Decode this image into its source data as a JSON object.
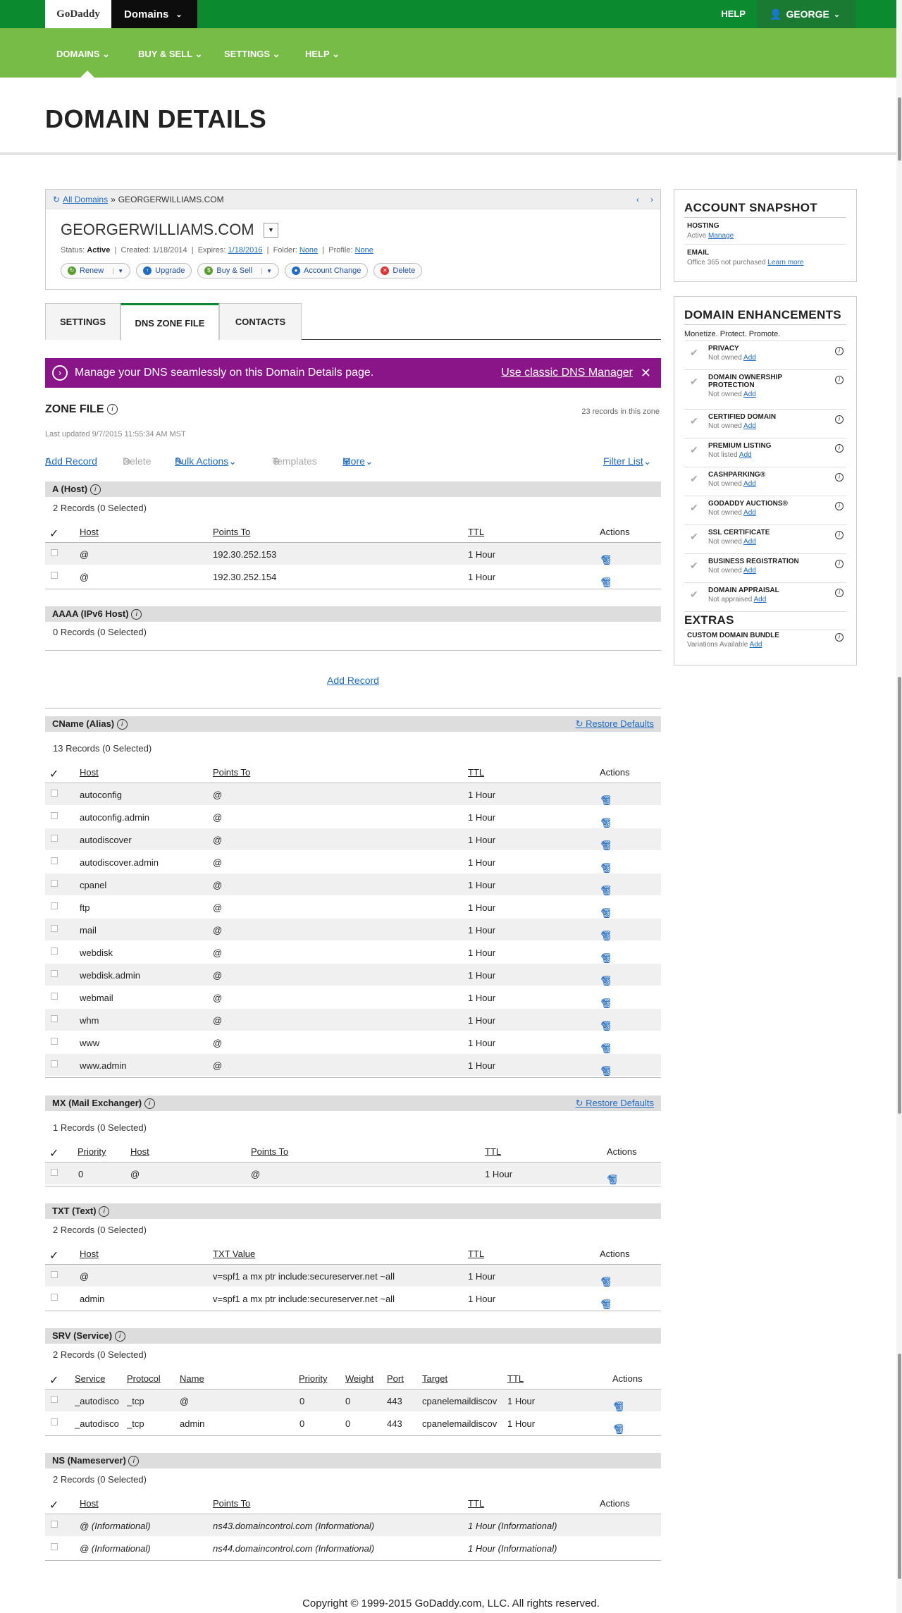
{
  "topbar": {
    "logo": "GoDaddy",
    "domains_label": "Domains",
    "help": "HELP",
    "user": "GEORGE"
  },
  "nav": {
    "items": [
      "DOMAINS",
      "BUY & SELL",
      "SETTINGS",
      "HELP"
    ]
  },
  "page": {
    "title": "DOMAIN DETAILS"
  },
  "card": {
    "breadcrumb_link": "All Domains",
    "breadcrumb_sep": "»",
    "breadcrumb_current": "GEORGERWILLIAMS.COM",
    "domain": "GEORGERWILLIAMS.COM",
    "status_label": "Status:",
    "status": "Active",
    "created": "Created: 1/18/2014",
    "expires_label": "Expires:",
    "expires": "1/18/2016",
    "folder_label": "Folder:",
    "folder": "None",
    "profile_label": "Profile:",
    "profile": "None",
    "actions": [
      "Renew",
      "Upgrade",
      "Buy & Sell",
      "Account Change",
      "Delete"
    ]
  },
  "tabs": [
    "SETTINGS",
    "DNS ZONE FILE",
    "CONTACTS"
  ],
  "banner": {
    "text": "Manage your DNS seamlessly on this Domain Details page.",
    "link": "Use classic DNS Manager",
    "close": "✕"
  },
  "zone": {
    "title": "ZONE FILE",
    "count": "23 records in this zone",
    "updated": "Last updated 9/7/2015 11:55:34 AM MST",
    "toolbar": {
      "add": "Add Record",
      "delete": "Delete",
      "bulk": "Bulk Actions",
      "templates": "Templates",
      "more": "More",
      "filter": "Filter List"
    }
  },
  "a": {
    "title": "A (Host)",
    "count": "2 Records (0 Selected)",
    "headers": [
      "Host",
      "Points To",
      "TTL",
      "Actions"
    ],
    "rows": [
      [
        "@",
        "192.30.252.153",
        "1 Hour"
      ],
      [
        "@",
        "192.30.252.154",
        "1 Hour"
      ]
    ]
  },
  "aaaa": {
    "title": "AAAA (IPv6 Host)",
    "count": "0 Records (0 Selected)",
    "add": "Add Record"
  },
  "cname": {
    "title": "CName (Alias)",
    "restore": "Restore Defaults",
    "count": "13 Records (0 Selected)",
    "headers": [
      "Host",
      "Points To",
      "TTL",
      "Actions"
    ],
    "rows": [
      [
        "autoconfig",
        "@",
        "1 Hour"
      ],
      [
        "autoconfig.admin",
        "@",
        "1 Hour"
      ],
      [
        "autodiscover",
        "@",
        "1 Hour"
      ],
      [
        "autodiscover.admin",
        "@",
        "1 Hour"
      ],
      [
        "cpanel",
        "@",
        "1 Hour"
      ],
      [
        "ftp",
        "@",
        "1 Hour"
      ],
      [
        "mail",
        "@",
        "1 Hour"
      ],
      [
        "webdisk",
        "@",
        "1 Hour"
      ],
      [
        "webdisk.admin",
        "@",
        "1 Hour"
      ],
      [
        "webmail",
        "@",
        "1 Hour"
      ],
      [
        "whm",
        "@",
        "1 Hour"
      ],
      [
        "www",
        "@",
        "1 Hour"
      ],
      [
        "www.admin",
        "@",
        "1 Hour"
      ]
    ]
  },
  "mx": {
    "title": "MX (Mail Exchanger)",
    "restore": "Restore Defaults",
    "count": "1 Records (0 Selected)",
    "headers": [
      "Priority",
      "Host",
      "Points To",
      "TTL",
      "Actions"
    ],
    "rows": [
      [
        "0",
        "@",
        "@",
        "1 Hour"
      ]
    ]
  },
  "txt": {
    "title": "TXT (Text)",
    "count": "2 Records (0 Selected)",
    "headers": [
      "Host",
      "TXT Value",
      "TTL",
      "Actions"
    ],
    "rows": [
      [
        "@",
        "v=spf1 a mx ptr include:secureserver.net ~all",
        "1 Hour"
      ],
      [
        "admin",
        "v=spf1 a mx ptr include:secureserver.net ~all",
        "1 Hour"
      ]
    ]
  },
  "srv": {
    "title": "SRV (Service)",
    "count": "2 Records (0 Selected)",
    "headers": [
      "Service",
      "Protocol",
      "Name",
      "Priority",
      "Weight",
      "Port",
      "Target",
      "TTL",
      "Actions"
    ],
    "rows": [
      [
        "_autodisco",
        "_tcp",
        "@",
        "0",
        "0",
        "443",
        "cpanelemaildiscov",
        "1 Hour"
      ],
      [
        "_autodisco",
        "_tcp",
        "admin",
        "0",
        "0",
        "443",
        "cpanelemaildiscov",
        "1 Hour"
      ]
    ]
  },
  "ns": {
    "title": "NS (Nameserver)",
    "count": "2 Records (0 Selected)",
    "headers": [
      "Host",
      "Points To",
      "TTL",
      "Actions"
    ],
    "rows": [
      [
        "@ (Informational)",
        "ns43.domaincontrol.com (Informational)",
        "1 Hour (Informational)"
      ],
      [
        "@ (Informational)",
        "ns44.domaincontrol.com (Informational)",
        "1 Hour (Informational)"
      ]
    ]
  },
  "snapshot": {
    "title": "ACCOUNT SNAPSHOT",
    "hosting_label": "HOSTING",
    "hosting_status": "Active",
    "hosting_link": "Manage",
    "email_label": "EMAIL",
    "email_status": "Office 365 not purchased",
    "email_link": "Learn more"
  },
  "enhancements": {
    "title": "DOMAIN ENHANCEMENTS",
    "subtitle": "Monetize. Protect. Promote.",
    "items": [
      {
        "name": "PRIVACY",
        "status": "Not owned",
        "link": "Add"
      },
      {
        "name": "DOMAIN OWNERSHIP PROTECTION",
        "status": "Not owned",
        "link": "Add"
      },
      {
        "name": "CERTIFIED DOMAIN",
        "status": "Not owned",
        "link": "Add"
      },
      {
        "name": "PREMIUM LISTING",
        "status": "Not listed",
        "link": "Add"
      },
      {
        "name": "CASHPARKING®",
        "status": "Not owned",
        "link": "Add"
      },
      {
        "name": "GODADDY AUCTIONS®",
        "status": "Not owned",
        "link": "Add"
      },
      {
        "name": "SSL CERTIFICATE",
        "status": "Not owned",
        "link": "Add"
      },
      {
        "name": "BUSINESS REGISTRATION",
        "status": "Not owned",
        "link": "Add"
      },
      {
        "name": "DOMAIN APPRAISAL",
        "status": "Not appraised",
        "link": "Add"
      }
    ],
    "extras_title": "EXTRAS",
    "extras": [
      {
        "name": "CUSTOM DOMAIN BUNDLE",
        "status": "Variations Available",
        "link": "Add"
      }
    ]
  },
  "footer": {
    "copyright": "Copyright © 1999-2015 GoDaddy.com, LLC. All rights reserved."
  },
  "colors": {
    "topbar": "#0b8a2f",
    "navbar": "#77bc47",
    "banner": "#8a1588",
    "link": "#1f6cc4"
  }
}
